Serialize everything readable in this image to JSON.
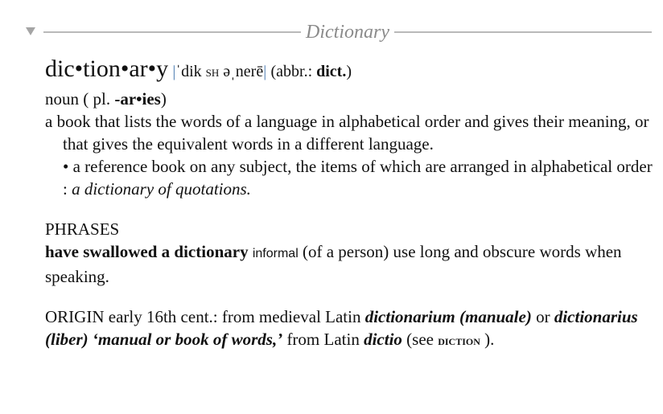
{
  "section": {
    "title": "Dictionary",
    "toggle_icon": "disclosure-triangle-down-icon"
  },
  "entry": {
    "headword": "dic•tion•ar•y",
    "pronunciation": {
      "open": "|",
      "part1": "ˈdik ",
      "sh": "SH",
      "part2": " əˌnerē",
      "close": "|"
    },
    "abbr_label": "(abbr.: ",
    "abbr_value": "dict.",
    "abbr_close": ")",
    "pos": "noun",
    "plural_open": " ( pl. ",
    "plural_form": "-ar•ies",
    "plural_close": ")",
    "definition_1": "a book that lists the words of a language in alphabetical order and gives their meaning, or that gives the equivalent words in a different language.",
    "subsense_bullet": "•",
    "subsense_text": " a reference book on any subject, the items of which are arranged in alphabetical order : ",
    "subsense_example": "a dictionary of quotations."
  },
  "phrases": {
    "heading": "PHRASES",
    "phrase": "have swallowed a dictionary",
    "register": "informal",
    "gloss": " (of a person) use long and obscure words when speaking."
  },
  "origin": {
    "label": "ORIGIN",
    "text1": " early 16th cent.: from medieval Latin ",
    "term1": "dictionarium (manuale)",
    "text2": " or ",
    "term2": "dictionarius (liber)",
    "term3": " ‘manual or book of words,’",
    "text3": " from Latin ",
    "term4": "dictio",
    "text4": " (see ",
    "crossref": "diction",
    "text5": " )."
  }
}
